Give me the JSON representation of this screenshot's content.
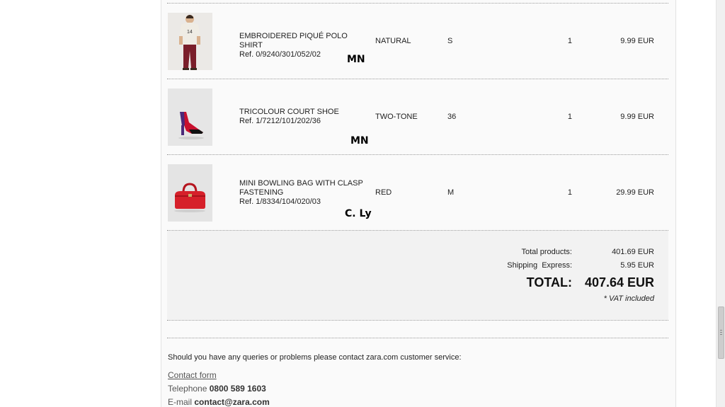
{
  "order_items": [
    {
      "name": "EMBROIDERED PIQUÉ POLO SHIRT",
      "ref": "Ref. 0/9240/301/052/02",
      "color": "NATURAL",
      "size": "S",
      "quantity": "1",
      "price": "9.99 EUR",
      "note": "MN",
      "image_icon": "polo-shirt-model-image"
    },
    {
      "name": "TRICOLOUR COURT SHOE",
      "ref": "Ref. 1/7212/101/202/36",
      "color": "TWO-TONE",
      "size": "36",
      "quantity": "1",
      "price": "9.99 EUR",
      "note": "MN",
      "image_icon": "court-shoe-image"
    },
    {
      "name": "MINI BOWLING BAG WITH CLASP FASTENING",
      "ref": "Ref. 1/8334/104/020/03",
      "color": "RED",
      "size": "M",
      "quantity": "1",
      "price": "29.99 EUR",
      "note": "C. Ly",
      "image_icon": "bowling-bag-image"
    }
  ],
  "totals": {
    "products_label": "Total products:",
    "products_value": "401.69 EUR",
    "shipping_label": "Shipping  Express:",
    "shipping_value": "5.95 EUR",
    "total_label": "TOTAL:",
    "total_value": "407.64 EUR",
    "vat_note": "* VAT included"
  },
  "footer": {
    "queries_text": "Should you have any queries or problems please contact zara.com customer service:",
    "contact_form_label": "Contact form",
    "telephone_label": "Telephone",
    "telephone_value": "0800 589 1603",
    "email_label": "E-mail",
    "email_value": "contact@zara.com"
  },
  "colors": {
    "page_background": "#fafafa",
    "totals_background": "#f2f2f2",
    "divider": "#9a9a9a",
    "shoe_red": "#c8102e",
    "shoe_purple": "#4b2a7a",
    "bag_red": "#d6202a"
  }
}
